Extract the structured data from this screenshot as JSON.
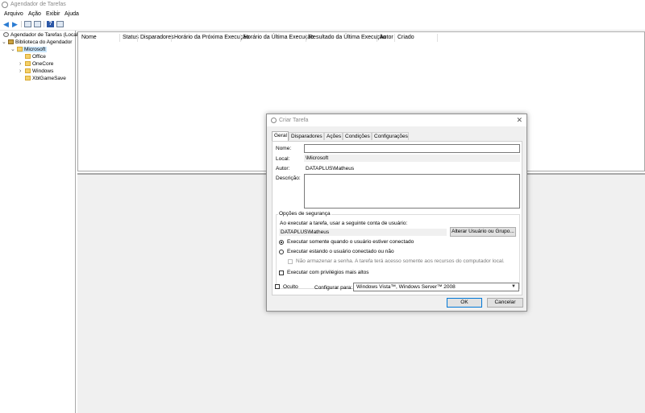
{
  "window": {
    "title": "Agendador de Tarefas"
  },
  "menu": [
    "Arquivo",
    "Ação",
    "Exibir",
    "Ajuda"
  ],
  "tree": {
    "root": "Agendador de Tarefas (Local)",
    "library": "Biblioteca do Agendador",
    "microsoft": "Microsoft",
    "children": [
      "Office",
      "OneCore",
      "Windows",
      "XblGameSave"
    ]
  },
  "columns": [
    "Nome",
    "Status",
    "Disparadores",
    "Horário da Próxima Execução",
    "Horário da Última Execução",
    "Resultado da Última Execução",
    "Autor",
    "Criado"
  ],
  "dialog": {
    "title": "Criar Tarefa",
    "tabs": [
      "Geral",
      "Disparadores",
      "Ações",
      "Condições",
      "Configurações"
    ],
    "name_label": "Nome:",
    "name_value": "",
    "location_label": "Local:",
    "location_value": "\\Microsoft",
    "author_label": "Autor:",
    "author_value": "DATAPLUS\\Matheus",
    "description_label": "Descrição:",
    "description_value": "",
    "security": {
      "legend": "Opções de segurança",
      "account_prompt": "Ao executar a tarefa, usar a seguinte conta de usuário:",
      "account_value": "DATAPLUS\\Matheus",
      "change_button": "Alterar Usuário ou Grupo...",
      "radio_logged_on": "Executar somente quando o usuário estiver conectado",
      "radio_always": "Executar estando o usuário conectado ou não",
      "no_store_password": "Não armazenar a senha. A tarefa terá acesso somente aos recursos do computador local.",
      "highest_privileges": "Executar com privilégios mais altos"
    },
    "hidden_label": "Oculto",
    "configure_label": "Configurar para:",
    "configure_value": "Windows Vista™, Windows Server™ 2008",
    "ok": "OK",
    "cancel": "Cancelar"
  }
}
